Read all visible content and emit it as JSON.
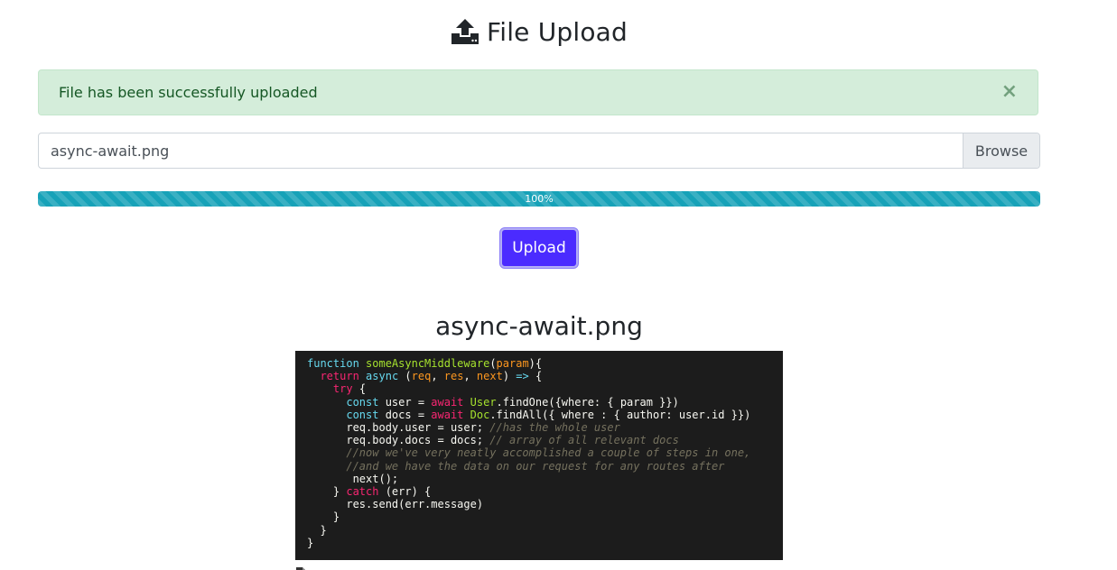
{
  "header": {
    "title": "File Upload",
    "icon": "upload-icon"
  },
  "alert": {
    "message": "File has been successfully uploaded",
    "close": "×",
    "color": "#155724",
    "background": "#d4edda"
  },
  "file_input": {
    "value": "async-await.png",
    "browse_label": "Browse"
  },
  "progress": {
    "value": 100,
    "label": "100%",
    "color": "#17a2b8"
  },
  "upload_button": {
    "label": "Upload",
    "color": "#4b2bff"
  },
  "uploaded": {
    "filename": "async-await.png",
    "code_lines": [
      "function someAsyncMiddleware(param){",
      "  return async (req, res, next) => {",
      "    try {",
      "      const user = await User.findOne({where: { param }})",
      "      const docs = await Doc.findAll({ where : { author: user.id }})",
      "      req.body.user = user; //has the whole user",
      "      req.body.docs = docs; // array of all relevant docs",
      "      //now we've very neatly accomplished a couple of steps in one,",
      "      //and we have the data on our request for any routes after",
      "       next();",
      "    } catch (err) {",
      "      res.send(err.message)",
      "    }",
      "  }",
      "}"
    ]
  }
}
